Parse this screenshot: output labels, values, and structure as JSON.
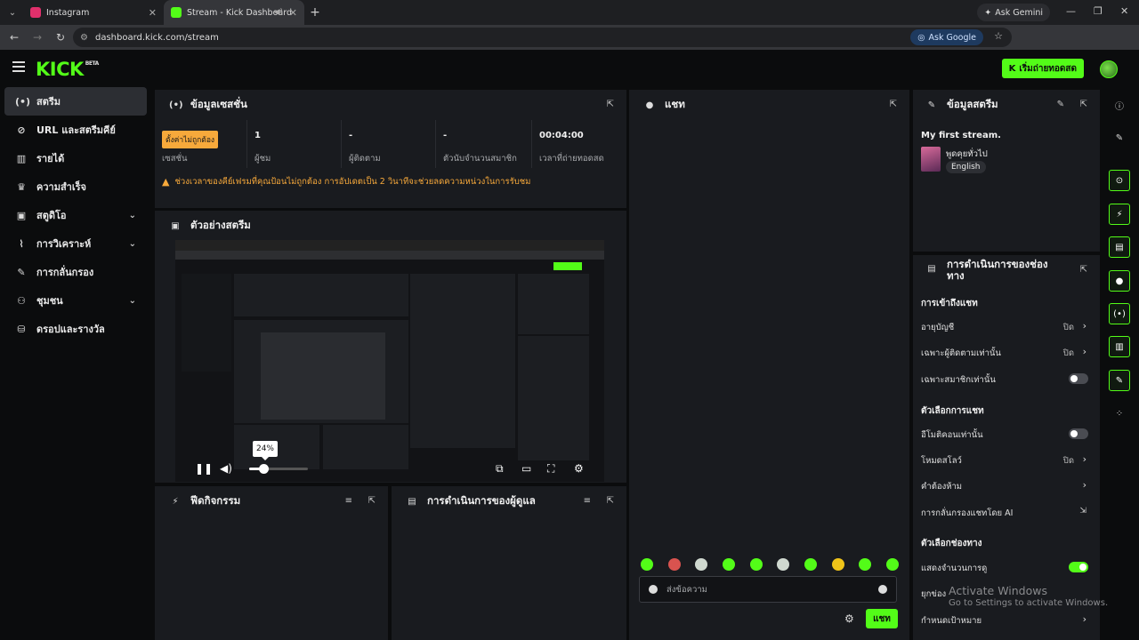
{
  "browser": {
    "tabs": [
      {
        "title": "Instagram",
        "active": false,
        "color": "#e1306c"
      },
      {
        "title": "Stream - Kick Dashboard",
        "active": true,
        "color": "#53fc18"
      }
    ],
    "new_tab": "+",
    "gemini": "Ask Gemini",
    "url": "dashboard.kick.com/stream",
    "ask_google": "Ask Google"
  },
  "header": {
    "logo": "KICK",
    "logo_badge": "BETA",
    "go_live": "เริ่มถ่ายทอดสด"
  },
  "sidebar": {
    "items": [
      {
        "label": "สตรีม",
        "icon": "stream-icon",
        "glyph": "(•)",
        "active": true,
        "chevron": false
      },
      {
        "label": "URL และสตรีมคีย์",
        "icon": "link-icon",
        "glyph": "⊘",
        "active": false,
        "chevron": false
      },
      {
        "label": "รายได้",
        "icon": "revenue-icon",
        "glyph": "▥",
        "active": false,
        "chevron": false
      },
      {
        "label": "ความสำเร็จ",
        "icon": "trophy-icon",
        "glyph": "♛",
        "active": false,
        "chevron": false
      },
      {
        "label": "สตูดิโอ",
        "icon": "studio-icon",
        "glyph": "▣",
        "active": false,
        "chevron": true
      },
      {
        "label": "การวิเคราะห์",
        "icon": "analytics-icon",
        "glyph": "⌇",
        "active": false,
        "chevron": true
      },
      {
        "label": "การกลั่นกรอง",
        "icon": "wrench-icon",
        "glyph": "✎",
        "active": false,
        "chevron": false
      },
      {
        "label": "ชุมชน",
        "icon": "community-icon",
        "glyph": "⚇",
        "active": false,
        "chevron": true
      },
      {
        "label": "ดรอปและรางวัล",
        "icon": "drops-icon",
        "glyph": "⛁",
        "active": false,
        "chevron": false
      }
    ]
  },
  "session": {
    "title": "ข้อมูลเซสชั่น",
    "stats": [
      {
        "value": "ตั้งค่าไม่ถูกต้อง",
        "label": "เซสชั่น",
        "is_badge": true
      },
      {
        "value": "1",
        "label": "ผู้ชม",
        "is_badge": false
      },
      {
        "value": "-",
        "label": "ผู้ติดตาม",
        "is_badge": false
      },
      {
        "value": "-",
        "label": "ตัวนับจำนวนสมาชิก",
        "is_badge": false
      },
      {
        "value": "00:04:00",
        "label": "เวลาที่ถ่ายทอดสด",
        "is_badge": false
      }
    ],
    "warning": "ช่วงเวลาของคีย์เฟรมที่คุณป้อนไม่ถูกต้อง การอัปเดตเป็น 2 วินาทีจะช่วยลดความหน่วงในการรับชม"
  },
  "preview": {
    "title": "ตัวอย่างสตรีม",
    "volume_tooltip": "24%",
    "volume": 0.24
  },
  "chat": {
    "title": "แชท",
    "placeholder": "ส่งข้อความ",
    "send": "แชท"
  },
  "stream_info": {
    "title": "ข้อมูลสตรีม",
    "stream_title": "My first stream.",
    "category": "พูดคุยทั่วไป",
    "language": "English"
  },
  "activity": {
    "title": "ฟีดกิจกรรม"
  },
  "mod_actions": {
    "title": "การดำเนินการของผู้ดูแล"
  },
  "channel_actions": {
    "title": "การดำเนินการของช่องทาง",
    "section_chat_access": "การเข้าถึงแชท",
    "account_age": {
      "label": "อายุบัญชี",
      "value": "ปิด"
    },
    "followers_only": {
      "label": "เฉพาะผู้ติดตามเท่านั้น",
      "value": "ปิด"
    },
    "subscribers_only": {
      "label": "เฉพาะสมาชิกเท่านั้น",
      "on": false
    },
    "section_chat_options": "ตัวเลือกการแชท",
    "emotes_only": {
      "label": "อีโมติคอนเท่านั้น",
      "on": false
    },
    "slow_mode": {
      "label": "โหมดสโลว์",
      "value": "ปิด"
    },
    "banned_words": {
      "label": "คำต้องห้าม"
    },
    "ai_moderation": {
      "label": "การกลั่นกรองแชทโดย AI"
    },
    "section_channel_options": "ตัวเลือกช่องทาง",
    "show_viewers": {
      "label": "แสดงจำนวนการดู",
      "on": true
    },
    "row_partial": "ยุกข่อง",
    "set_goal": {
      "label": "กำหนดเป้าหมาย"
    }
  },
  "windows": {
    "line1": "Activate Windows",
    "line2": "Go to Settings to activate Windows."
  },
  "colors": {
    "accent": "#53fc18",
    "warning": "#f7a93b",
    "panel": "#191b1f"
  }
}
